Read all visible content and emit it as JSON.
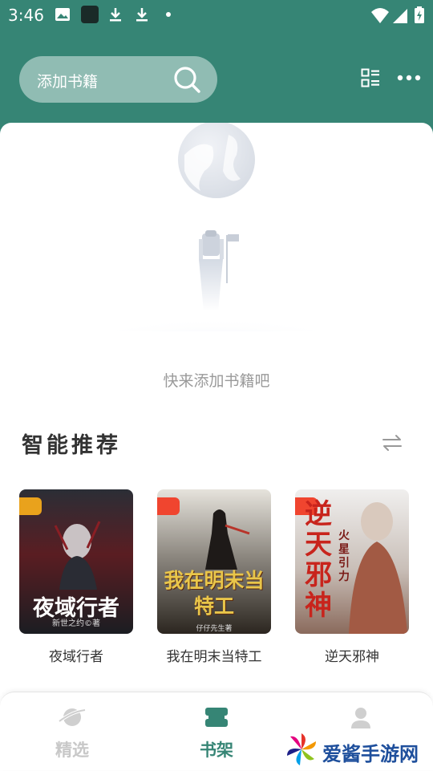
{
  "status_bar": {
    "time": "3:46"
  },
  "search": {
    "placeholder": "添加书籍"
  },
  "shelf": {
    "empty_text": "快来添加书籍吧"
  },
  "recommend": {
    "title": "智能推荐",
    "books": [
      {
        "title": "夜域行者",
        "cover_text": "夜域行者",
        "cover_author": "新世之约©著"
      },
      {
        "title": "我在明末当特工",
        "cover_text": "我在明末当特工",
        "cover_author": "仔仔先生著"
      },
      {
        "title": "逆天邪神",
        "cover_text": "逆天邪神",
        "cover_sub": "火星引力"
      }
    ]
  },
  "nav": {
    "items": [
      {
        "label": "精选",
        "active": false
      },
      {
        "label": "书架",
        "active": true
      },
      {
        "label": "我的",
        "active": false
      }
    ]
  },
  "watermark": {
    "text": "爱酱手游网"
  },
  "colors": {
    "primary": "#368575",
    "inactive": "#c8c8c8"
  }
}
